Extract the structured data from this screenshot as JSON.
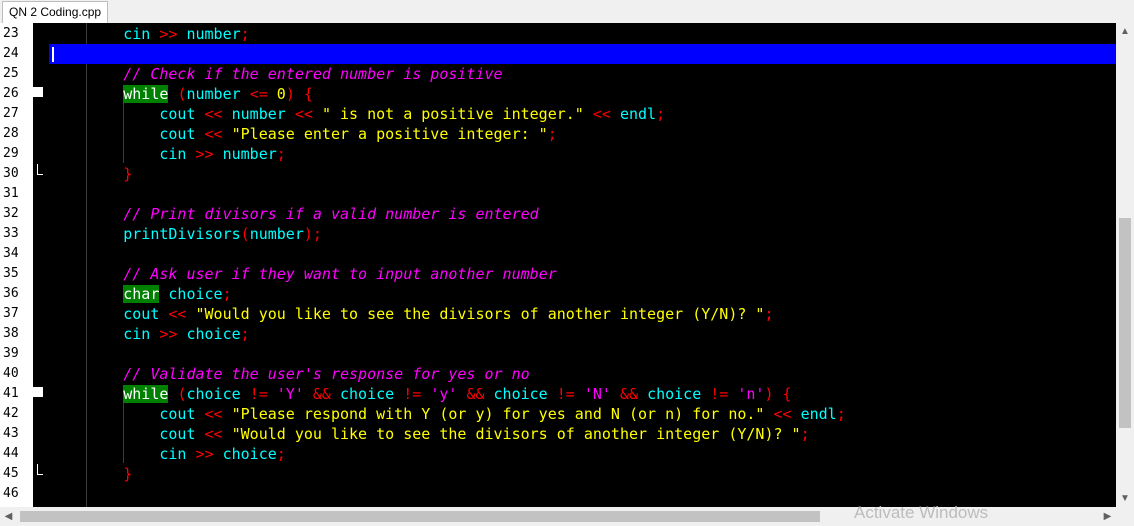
{
  "tab": {
    "title": "QN 2 Coding.cpp"
  },
  "watermark": "Activate Windows",
  "lines": [
    {
      "n": "23",
      "tokens": [
        [
          "        ",
          ""
        ],
        [
          "cin",
          "id"
        ],
        [
          " ",
          ""
        ],
        [
          ">>",
          "op"
        ],
        [
          " ",
          ""
        ],
        [
          "number",
          "id"
        ],
        [
          ";",
          "pn"
        ]
      ]
    },
    {
      "n": "24",
      "current": true,
      "tokens": []
    },
    {
      "n": "25",
      "tokens": [
        [
          "        ",
          ""
        ],
        [
          "// Check if the entered number is positive",
          "cm"
        ]
      ]
    },
    {
      "n": "26",
      "marker": true,
      "tokens": [
        [
          "        ",
          ""
        ],
        [
          "while",
          "kw"
        ],
        [
          " ",
          ""
        ],
        [
          "(",
          "pn"
        ],
        [
          "number",
          "id"
        ],
        [
          " ",
          ""
        ],
        [
          "<=",
          "op"
        ],
        [
          " ",
          ""
        ],
        [
          "0",
          "num"
        ],
        [
          ")",
          "pn"
        ],
        [
          " ",
          ""
        ],
        [
          "{",
          "pn"
        ]
      ]
    },
    {
      "n": "27",
      "tokens": [
        [
          "            ",
          ""
        ],
        [
          "cout",
          "id"
        ],
        [
          " ",
          ""
        ],
        [
          "<<",
          "op"
        ],
        [
          " ",
          ""
        ],
        [
          "number",
          "id"
        ],
        [
          " ",
          ""
        ],
        [
          "<<",
          "op"
        ],
        [
          " ",
          ""
        ],
        [
          "\" is not a positive integer.\"",
          "str"
        ],
        [
          " ",
          ""
        ],
        [
          "<<",
          "op"
        ],
        [
          " ",
          ""
        ],
        [
          "endl",
          "id"
        ],
        [
          ";",
          "pn"
        ]
      ]
    },
    {
      "n": "28",
      "tokens": [
        [
          "            ",
          ""
        ],
        [
          "cout",
          "id"
        ],
        [
          " ",
          ""
        ],
        [
          "<<",
          "op"
        ],
        [
          " ",
          ""
        ],
        [
          "\"Please enter a positive integer: \"",
          "str"
        ],
        [
          ";",
          "pn"
        ]
      ]
    },
    {
      "n": "29",
      "tokens": [
        [
          "            ",
          ""
        ],
        [
          "cin",
          "id"
        ],
        [
          " ",
          ""
        ],
        [
          ">>",
          "op"
        ],
        [
          " ",
          ""
        ],
        [
          "number",
          "id"
        ],
        [
          ";",
          "pn"
        ]
      ]
    },
    {
      "n": "30",
      "fold": true,
      "tokens": [
        [
          "        ",
          ""
        ],
        [
          "}",
          "pn"
        ]
      ]
    },
    {
      "n": "31",
      "tokens": []
    },
    {
      "n": "32",
      "tokens": [
        [
          "        ",
          ""
        ],
        [
          "// Print divisors if a valid number is entered",
          "cm"
        ]
      ]
    },
    {
      "n": "33",
      "tokens": [
        [
          "        ",
          ""
        ],
        [
          "printDivisors",
          "id"
        ],
        [
          "(",
          "pn"
        ],
        [
          "number",
          "id"
        ],
        [
          ");",
          "pn"
        ]
      ]
    },
    {
      "n": "34",
      "tokens": []
    },
    {
      "n": "35",
      "tokens": [
        [
          "        ",
          ""
        ],
        [
          "// Ask user if they want to input another number",
          "cm"
        ]
      ]
    },
    {
      "n": "36",
      "tokens": [
        [
          "        ",
          ""
        ],
        [
          "char",
          "kw"
        ],
        [
          " ",
          ""
        ],
        [
          "choice",
          "id"
        ],
        [
          ";",
          "pn"
        ]
      ]
    },
    {
      "n": "37",
      "tokens": [
        [
          "        ",
          ""
        ],
        [
          "cout",
          "id"
        ],
        [
          " ",
          ""
        ],
        [
          "<<",
          "op"
        ],
        [
          " ",
          ""
        ],
        [
          "\"Would you like to see the divisors of another integer (Y/N)? \"",
          "str"
        ],
        [
          ";",
          "pn"
        ]
      ]
    },
    {
      "n": "38",
      "tokens": [
        [
          "        ",
          ""
        ],
        [
          "cin",
          "id"
        ],
        [
          " ",
          ""
        ],
        [
          ">>",
          "op"
        ],
        [
          " ",
          ""
        ],
        [
          "choice",
          "id"
        ],
        [
          ";",
          "pn"
        ]
      ]
    },
    {
      "n": "39",
      "tokens": []
    },
    {
      "n": "40",
      "tokens": [
        [
          "        ",
          ""
        ],
        [
          "// Validate the user's response for yes or no",
          "cm"
        ]
      ]
    },
    {
      "n": "41",
      "marker": true,
      "tokens": [
        [
          "        ",
          ""
        ],
        [
          "while",
          "kw"
        ],
        [
          " ",
          ""
        ],
        [
          "(",
          "pn"
        ],
        [
          "choice",
          "id"
        ],
        [
          " ",
          ""
        ],
        [
          "!=",
          "op"
        ],
        [
          " ",
          ""
        ],
        [
          "'Y'",
          "chr"
        ],
        [
          " ",
          ""
        ],
        [
          "&&",
          "op"
        ],
        [
          " ",
          ""
        ],
        [
          "choice",
          "id"
        ],
        [
          " ",
          ""
        ],
        [
          "!=",
          "op"
        ],
        [
          " ",
          ""
        ],
        [
          "'y'",
          "chr"
        ],
        [
          " ",
          ""
        ],
        [
          "&&",
          "op"
        ],
        [
          " ",
          ""
        ],
        [
          "choice",
          "id"
        ],
        [
          " ",
          ""
        ],
        [
          "!=",
          "op"
        ],
        [
          " ",
          ""
        ],
        [
          "'N'",
          "chr"
        ],
        [
          " ",
          ""
        ],
        [
          "&&",
          "op"
        ],
        [
          " ",
          ""
        ],
        [
          "choice",
          "id"
        ],
        [
          " ",
          ""
        ],
        [
          "!=",
          "op"
        ],
        [
          " ",
          ""
        ],
        [
          "'n'",
          "chr"
        ],
        [
          ")",
          "pn"
        ],
        [
          " ",
          ""
        ],
        [
          "{",
          "pn"
        ]
      ]
    },
    {
      "n": "42",
      "tokens": [
        [
          "            ",
          ""
        ],
        [
          "cout",
          "id"
        ],
        [
          " ",
          ""
        ],
        [
          "<<",
          "op"
        ],
        [
          " ",
          ""
        ],
        [
          "\"Please respond with Y (or y) for yes and N (or n) for no.\"",
          "str"
        ],
        [
          " ",
          ""
        ],
        [
          "<<",
          "op"
        ],
        [
          " ",
          ""
        ],
        [
          "endl",
          "id"
        ],
        [
          ";",
          "pn"
        ]
      ]
    },
    {
      "n": "43",
      "tokens": [
        [
          "            ",
          ""
        ],
        [
          "cout",
          "id"
        ],
        [
          " ",
          ""
        ],
        [
          "<<",
          "op"
        ],
        [
          " ",
          ""
        ],
        [
          "\"Would you like to see the divisors of another integer (Y/N)? \"",
          "str"
        ],
        [
          ";",
          "pn"
        ]
      ]
    },
    {
      "n": "44",
      "tokens": [
        [
          "            ",
          ""
        ],
        [
          "cin",
          "id"
        ],
        [
          " ",
          ""
        ],
        [
          ">>",
          "op"
        ],
        [
          " ",
          ""
        ],
        [
          "choice",
          "id"
        ],
        [
          ";",
          "pn"
        ]
      ]
    },
    {
      "n": "45",
      "fold": true,
      "tokens": [
        [
          "        ",
          ""
        ],
        [
          "}",
          "pn"
        ]
      ]
    },
    {
      "n": "46",
      "tokens": []
    }
  ]
}
